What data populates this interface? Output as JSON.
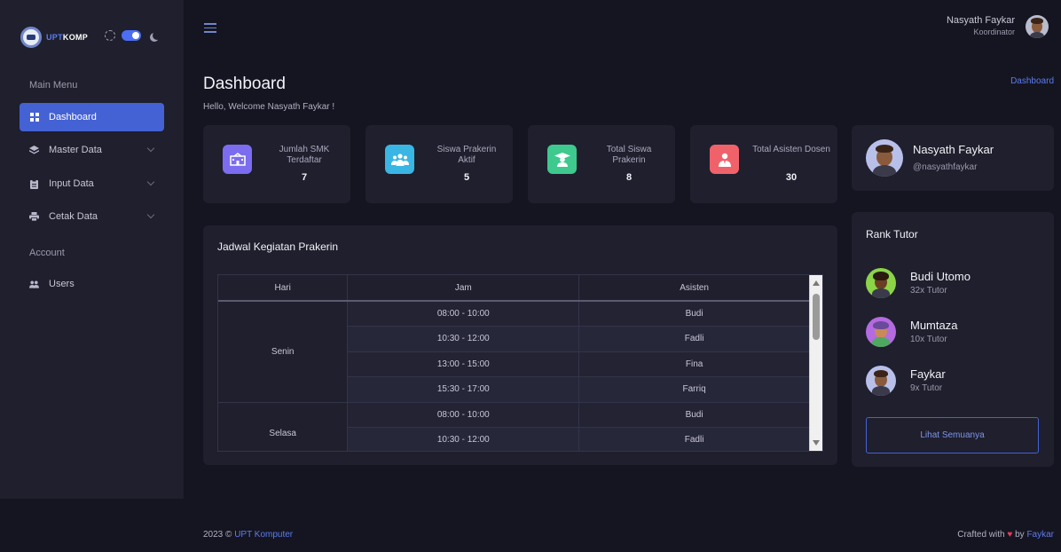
{
  "brand": {
    "name_part1": "UPT",
    "name_part2": "KOMP"
  },
  "sidebar": {
    "section_main": "Main Menu",
    "section_account": "Account",
    "items": [
      {
        "label": "Dashboard",
        "icon": "grid-icon"
      },
      {
        "label": "Master Data",
        "icon": "layers-icon"
      },
      {
        "label": "Input Data",
        "icon": "clipboard-icon"
      },
      {
        "label": "Cetak Data",
        "icon": "printer-icon"
      },
      {
        "label": "Users",
        "icon": "users-icon"
      }
    ]
  },
  "header": {
    "user_name": "Nasyath Faykar",
    "user_role": "Koordinator"
  },
  "page": {
    "title": "Dashboard",
    "welcome": "Hello, Welcome Nasyath Faykar !",
    "breadcrumb": "Dashboard"
  },
  "stats": [
    {
      "label": "Jumlah SMK Terdaftar",
      "value": "7",
      "color": "#7b6cf0",
      "icon": "school-icon"
    },
    {
      "label": "Siswa Prakerin Aktif",
      "value": "5",
      "color": "#39b6e3",
      "icon": "people-icon"
    },
    {
      "label": "Total Siswa Prakerin",
      "value": "8",
      "color": "#3ec98e",
      "icon": "graduate-icon"
    },
    {
      "label": "Total Asisten Dosen",
      "value": "30",
      "color": "#f0626a",
      "icon": "assistant-icon"
    }
  ],
  "schedule": {
    "title": "Jadwal Kegiatan Prakerin",
    "columns": [
      "Hari",
      "Jam",
      "Asisten"
    ],
    "days": [
      {
        "day": "Senin",
        "rows": [
          {
            "jam": "08:00 - 10:00",
            "asisten": "Budi"
          },
          {
            "jam": "10:30 - 12:00",
            "asisten": "Fadli"
          },
          {
            "jam": "13:00 - 15:00",
            "asisten": "Fina"
          },
          {
            "jam": "15:30 - 17:00",
            "asisten": "Farriq"
          }
        ]
      },
      {
        "day": "Selasa",
        "rows": [
          {
            "jam": "08:00 - 10:00",
            "asisten": "Budi"
          },
          {
            "jam": "10:30 - 12:00",
            "asisten": "Fadli"
          }
        ]
      }
    ]
  },
  "profile": {
    "name": "Nasyath Faykar",
    "handle": "@nasyathfaykar"
  },
  "rank": {
    "title": "Rank Tutor",
    "tutors": [
      {
        "name": "Budi Utomo",
        "count": "32x Tutor",
        "bg": "#8bd448"
      },
      {
        "name": "Mumtaza",
        "count": "10x Tutor",
        "bg": "#b46ae0"
      },
      {
        "name": "Faykar",
        "count": "9x Tutor",
        "bg": "#b8c0ea"
      }
    ],
    "button": "Lihat Semuanya"
  },
  "footer": {
    "year": "2023 ©",
    "org": "UPT Komputer",
    "crafted": "Crafted with",
    "by": "by",
    "author": "Faykar"
  }
}
